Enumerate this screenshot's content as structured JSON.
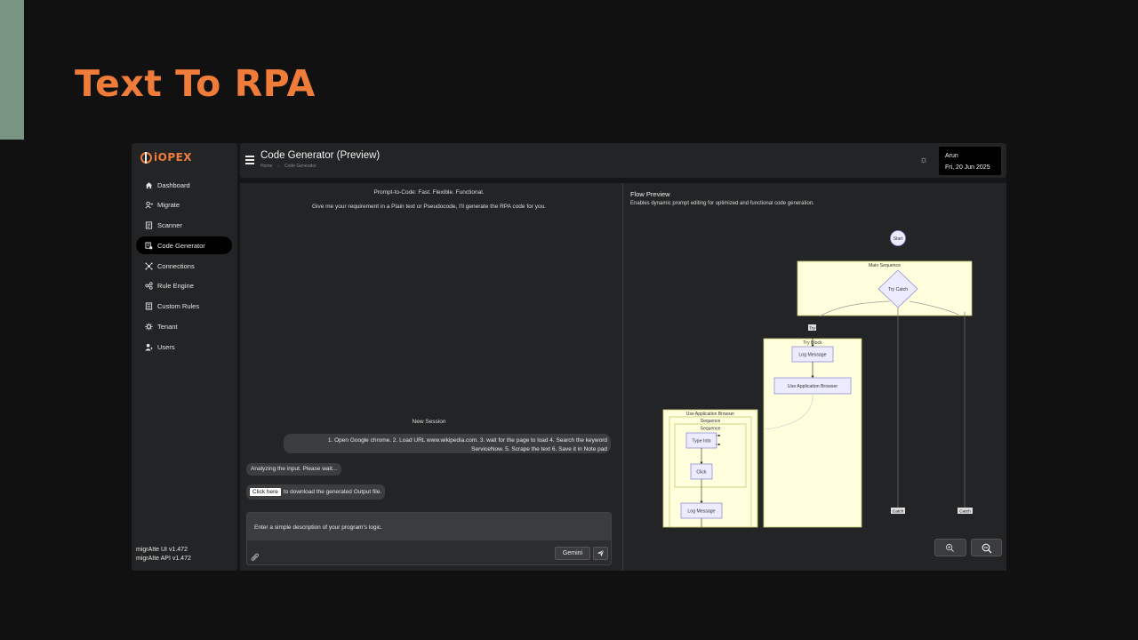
{
  "slide": {
    "title": "Text To RPA",
    "accent_color": "#7a9482",
    "title_color": "#f07c3a"
  },
  "app": {
    "logo": "iOPEX",
    "sidebar": {
      "items": [
        {
          "label": "Dashboard",
          "icon": "home-icon"
        },
        {
          "label": "Migrate",
          "icon": "migrate-icon"
        },
        {
          "label": "Scanner",
          "icon": "scanner-icon"
        },
        {
          "label": "Code Generator",
          "icon": "code-generator-icon",
          "active": true
        },
        {
          "label": "Connections",
          "icon": "connections-icon"
        },
        {
          "label": "Rule Engine",
          "icon": "rule-engine-icon"
        },
        {
          "label": "Custom Rules",
          "icon": "custom-rules-icon"
        },
        {
          "label": "Tenant",
          "icon": "tenant-icon"
        },
        {
          "label": "Users",
          "icon": "users-icon"
        }
      ],
      "version_ui": "migrAIte UI v1.472",
      "version_api": "migrAIte API v1.472"
    },
    "header": {
      "title": "Code Generator (Preview)",
      "breadcrumb": [
        "Home",
        "Code Generator"
      ],
      "breadcrumb_sep": "›",
      "user": "Arun",
      "date": "Fri, 20 Jun 2025"
    },
    "chat": {
      "heading": "Prompt-to-Code: Fast. Flexible. Functional.",
      "subheading": "Give me your requirement in a Plain text or Pseudocode, I'll generate the RPA code for you.",
      "session_label": "New Session",
      "user_message_line1": "1. Open Google chrome. 2. Load URL www.wikipedia.com. 3. wait for the page to load 4. Search the keyword",
      "user_message_line2": "ServiceNow. 5. Scrape the text 6. Save it in Note pad",
      "status_message": "Analyzing the input. Please wait...",
      "download_button": "Click here",
      "download_text": "to download the generated Output file.",
      "input_placeholder": "Enter a simple description of your program's logic.",
      "model": "Gemini"
    },
    "flow": {
      "title": "Flow Preview",
      "description": "Enables dynamic prompt editing for optimized and functional code generation.",
      "nodes": {
        "start": "Start",
        "main_sequence": "Main Sequence",
        "try_catch": "Try Catch",
        "try_label": "Try",
        "try_block": "Try Block",
        "log_message_1": "Log Message",
        "use_app_browser_node": "Use Application Browser",
        "use_app_browser_container": "Use Application Browser",
        "sequence_outer": "Sequence",
        "sequence_inner": "Sequence",
        "type_into": "Type Into",
        "click": "Click",
        "log_message_2": "Log Message",
        "catch_1": "Catch",
        "catch_2": "Catch"
      }
    }
  }
}
